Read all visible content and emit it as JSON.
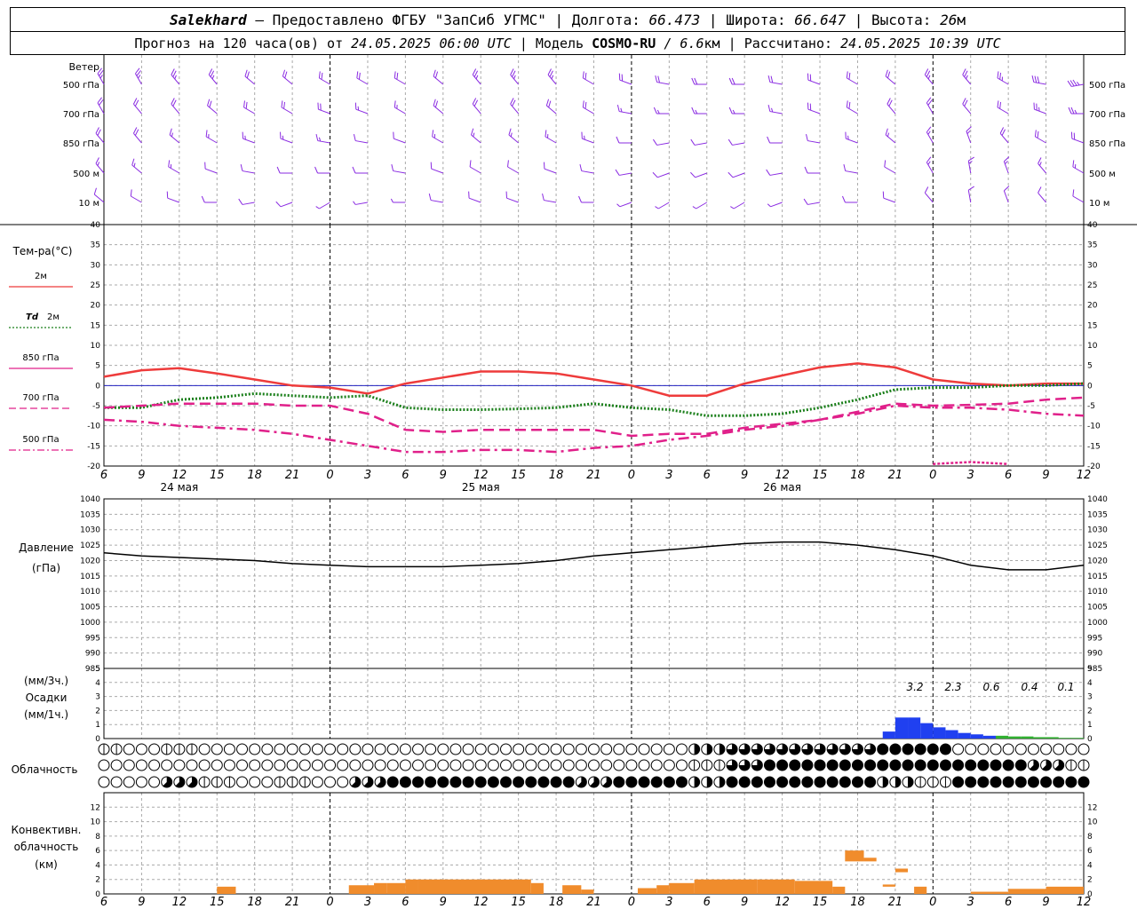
{
  "header": {
    "station": "Salekhard",
    "provider": "– Предоставлено ФГБУ \"ЗапСиб УГМС\"",
    "lon_label": "Долгота:",
    "lon_value": "66.473",
    "lat_label": "Широта:",
    "lat_value": "66.647",
    "alt_label": "Высота:",
    "alt_value": "26",
    "alt_unit": "м",
    "forecast_label": "Прогноз на 120 часа(ов) от",
    "forecast_start": "24.05.2025 06:00 UTC",
    "model_label": "Модель",
    "model_name": "COSMO-RU",
    "model_res": "/ 6.6",
    "model_res_unit": "км",
    "calc_label": "Рассчитано:",
    "calc_time": "24.05.2025 10:39 UTC",
    "sep": "|"
  },
  "x_axis": {
    "hour_labels": [
      "6",
      "9",
      "12",
      "15",
      "18",
      "21",
      "0",
      "3",
      "6",
      "9",
      "12",
      "15",
      "18",
      "21",
      "0",
      "3",
      "6",
      "9",
      "12",
      "15",
      "18",
      "21",
      "0",
      "3",
      "6",
      "9",
      "12"
    ],
    "day_labels": [
      "24 мая",
      "25 мая",
      "26 мая"
    ]
  },
  "wind_panel": {
    "title": "Ветер",
    "levels": [
      "500 гПа",
      "700 гПа",
      "850 гПа",
      "500 м",
      "10 м"
    ],
    "color": "#8a2be2"
  },
  "temp_panel": {
    "title": "Тем-ра(°C)",
    "legend": [
      {
        "label": "2м",
        "color": "#ee3b3b",
        "style": "solid"
      },
      {
        "label_prefix": "Td",
        "label": "2м",
        "color": "#1a7f1a",
        "style": "dotted"
      },
      {
        "label": "850 гПа",
        "color": "#e0208a",
        "style": "solid"
      },
      {
        "label": "700 гПа",
        "color": "#e0208a",
        "style": "dash"
      },
      {
        "label": "500 гПа",
        "color": "#e0208a",
        "style": "dashdot"
      }
    ]
  },
  "pressure_panel": {
    "title1": "Давление",
    "title2": "(гПа)"
  },
  "precip_panel": {
    "title1": "(мм/3ч.)",
    "title2": "Осадки",
    "title3": "(мм/1ч.)",
    "totals": [
      "3.2",
      "2.3",
      "0.6",
      "0.4",
      "0.1"
    ]
  },
  "cloud_panel": {
    "title": "Облачность"
  },
  "conv_panel": {
    "title1": "Конвективн.",
    "title2": "облачность",
    "title3": "(км)"
  },
  "chart_data": [
    {
      "type": "line",
      "name": "temperature",
      "ylim": [
        -20,
        40
      ],
      "yticks": [
        -20,
        -15,
        -10,
        -5,
        0,
        5,
        10,
        15,
        20,
        25,
        30,
        35,
        40
      ],
      "x_hours": [
        0,
        3,
        6,
        9,
        12,
        15,
        18,
        21,
        24,
        27,
        30,
        33,
        36,
        39,
        42,
        45,
        48,
        51,
        54,
        57,
        60,
        63,
        66,
        69,
        72,
        75,
        78
      ],
      "series": [
        {
          "name": "2м",
          "values": [
            2.2,
            3.8,
            4.3,
            3.0,
            1.5,
            0,
            -0.5,
            -2.0,
            0.5,
            2.0,
            3.5,
            3.5,
            3.0,
            1.5,
            0,
            -2.5,
            -2.5,
            0.5,
            2.5,
            4.5,
            5.5,
            4.5,
            1.5,
            0.5,
            0,
            0.5,
            0.5
          ]
        },
        {
          "name": "Td 2м",
          "values": [
            -5.5,
            -5.5,
            -3.5,
            -3.0,
            -2.0,
            -2.5,
            -3.0,
            -2.5,
            -5.5,
            -6.0,
            -6.0,
            -5.8,
            -5.5,
            -4.5,
            -5.5,
            -6.0,
            -7.5,
            -7.5,
            -7.0,
            -5.5,
            -3.5,
            -1.0,
            -0.5,
            -0.5,
            0,
            0,
            0.5
          ]
        },
        {
          "name": "850 гПа",
          "values": [
            null,
            null,
            null,
            null,
            null,
            null,
            null,
            null,
            null,
            null,
            null,
            null,
            null,
            null,
            null,
            null,
            null,
            null,
            null,
            null,
            null,
            null,
            -19.5,
            -19.0,
            -19.5,
            null,
            null
          ]
        },
        {
          "name": "700 гПа",
          "values": [
            -5.5,
            -5.0,
            -4.5,
            -4.5,
            -4.5,
            -5.0,
            -5.0,
            -7.0,
            -11.0,
            -11.5,
            -11.0,
            -11.0,
            -11.0,
            -11.0,
            -12.5,
            -12.0,
            -12.0,
            -10.5,
            -9.5,
            -8.5,
            -6.5,
            -4.5,
            -5.0,
            -4.8,
            -4.5,
            -3.5,
            -3.0
          ]
        },
        {
          "name": "500 гПа",
          "values": [
            -8.5,
            -9.0,
            -10.0,
            -10.5,
            -11.0,
            -12.0,
            -13.5,
            -15.0,
            -16.5,
            -16.5,
            -16.0,
            -16.0,
            -16.5,
            -15.5,
            -15.0,
            -13.5,
            -12.5,
            -11.0,
            -10.0,
            -8.5,
            -7.0,
            -5.0,
            -5.5,
            -5.5,
            -6.0,
            -7.0,
            -7.5
          ]
        }
      ]
    },
    {
      "type": "line",
      "name": "pressure",
      "ylim": [
        985,
        1040
      ],
      "yticks": [
        985,
        990,
        995,
        1000,
        1005,
        1010,
        1015,
        1020,
        1025,
        1030,
        1035,
        1040
      ],
      "x_hours": [
        0,
        3,
        6,
        9,
        12,
        15,
        18,
        21,
        24,
        27,
        30,
        33,
        36,
        39,
        42,
        45,
        48,
        51,
        54,
        57,
        60,
        63,
        66,
        69,
        72,
        75,
        78
      ],
      "series": [
        {
          "name": "Давление",
          "values": [
            1022.5,
            1021.5,
            1021.0,
            1020.5,
            1020.0,
            1019.0,
            1018.5,
            1018.0,
            1018.0,
            1018.0,
            1018.5,
            1019.0,
            1020.0,
            1021.5,
            1022.5,
            1023.5,
            1024.5,
            1025.5,
            1026.0,
            1026.0,
            1025.0,
            1023.5,
            1021.5,
            1018.5,
            1017.0,
            1017.0,
            1018.5
          ]
        }
      ]
    },
    {
      "type": "bar",
      "name": "precipitation",
      "ylim": [
        0,
        5
      ],
      "yticks": [
        0,
        1,
        2,
        3,
        4,
        5
      ],
      "hours": [
        63,
        64,
        65,
        66,
        67,
        68,
        69,
        70,
        71,
        72,
        73,
        74,
        75,
        76,
        77,
        78
      ],
      "values": [
        0.5,
        1.5,
        1.5,
        1.1,
        0.8,
        0.6,
        0.4,
        0.3,
        0.2,
        0.2,
        0.15,
        0.15,
        0.1,
        0.1,
        0.05,
        0.05
      ],
      "colors": [
        "#2040f0",
        "#2040f0",
        "#2040f0",
        "#2040f0",
        "#2040f0",
        "#2040f0",
        "#2040f0",
        "#2040f0",
        "#2040f0",
        "#30b030",
        "#30b030",
        "#30b030",
        "#30b030",
        "#30b030",
        "#30b030",
        "#30b030"
      ]
    },
    {
      "type": "bar",
      "name": "convective_cloud",
      "ylim": [
        0,
        14
      ],
      "yticks": [
        0,
        2,
        4,
        6,
        8,
        10,
        12
      ],
      "segments": [
        {
          "from": 9,
          "to": 10.5,
          "base": 0,
          "top": 1.0
        },
        {
          "from": 19.5,
          "to": 21.5,
          "base": 0,
          "top": 1.2
        },
        {
          "from": 21.5,
          "to": 22.5,
          "base": 0,
          "top": 1.5
        },
        {
          "from": 22.5,
          "to": 24,
          "base": 0,
          "top": 1.5
        },
        {
          "from": 24,
          "to": 25,
          "base": 0,
          "top": 2.0
        },
        {
          "from": 25,
          "to": 34,
          "base": 0,
          "top": 2.0
        },
        {
          "from": 34,
          "to": 35,
          "base": 0,
          "top": 1.5
        },
        {
          "from": 36.5,
          "to": 38,
          "base": 0,
          "top": 1.2
        },
        {
          "from": 38,
          "to": 39,
          "base": 0,
          "top": 0.6
        },
        {
          "from": 42.5,
          "to": 44,
          "base": 0,
          "top": 0.8
        },
        {
          "from": 44,
          "to": 45,
          "base": 0,
          "top": 1.2
        },
        {
          "from": 45,
          "to": 47,
          "base": 0,
          "top": 1.5
        },
        {
          "from": 47,
          "to": 52,
          "base": 0,
          "top": 2.0
        },
        {
          "from": 52,
          "to": 55,
          "base": 0,
          "top": 2.0
        },
        {
          "from": 55,
          "to": 58,
          "base": 0,
          "top": 1.8
        },
        {
          "from": 58,
          "to": 59,
          "base": 0,
          "top": 1.0
        },
        {
          "from": 59,
          "to": 60.5,
          "base": 4.5,
          "top": 6.0
        },
        {
          "from": 60.5,
          "to": 61.5,
          "base": 4.5,
          "top": 5.0
        },
        {
          "from": 62,
          "to": 63,
          "base": 1.0,
          "top": 1.3
        },
        {
          "from": 63,
          "to": 64,
          "base": 3.0,
          "top": 3.5
        },
        {
          "from": 64.5,
          "to": 65.5,
          "base": 0,
          "top": 1.0
        },
        {
          "from": 69,
          "to": 72,
          "base": 0,
          "top": 0.3
        },
        {
          "from": 72,
          "to": 75,
          "base": 0,
          "top": 0.7
        },
        {
          "from": 75,
          "to": 78,
          "base": 0,
          "top": 1.0
        }
      ]
    },
    {
      "type": "table",
      "name": "cloud_cover",
      "rows": [
        "upper",
        "middle",
        "lower"
      ],
      "hours": [
        0,
        3,
        6,
        9,
        12,
        15,
        18,
        21,
        24,
        27,
        30,
        33,
        36,
        39,
        42,
        45,
        48,
        51,
        54,
        57,
        60,
        63,
        66,
        69,
        72,
        75,
        78
      ],
      "upper": [
        1,
        0,
        1,
        0,
        0,
        0,
        0,
        0,
        0,
        0,
        0,
        0,
        0,
        0,
        0,
        0,
        4,
        6,
        6,
        6,
        6,
        8,
        8,
        0,
        0,
        0,
        0
      ],
      "middle": [
        0,
        0,
        0,
        0,
        0,
        0,
        0,
        0,
        0,
        0,
        0,
        0,
        0,
        0,
        0,
        0,
        2,
        6,
        8,
        8,
        8,
        8,
        8,
        8,
        8,
        5,
        2
      ],
      "lower": [
        0,
        0,
        5,
        1,
        0,
        1,
        0,
        5,
        8,
        8,
        8,
        8,
        8,
        5,
        8,
        8,
        4,
        8,
        8,
        8,
        8,
        4,
        1,
        8,
        8,
        8,
        8
      ]
    },
    {
      "type": "scatter",
      "name": "wind_barbs",
      "levels": [
        "500 гПа",
        "700 гПа",
        "850 гПа",
        "500 м",
        "10 м"
      ],
      "x_hours": [
        0,
        3,
        6,
        9,
        12,
        15,
        18,
        21,
        24,
        27,
        30,
        33,
        36,
        39,
        42,
        45,
        48,
        51,
        54,
        57,
        60,
        63,
        66,
        69,
        72,
        75,
        78
      ],
      "direction_deg": [
        [
          330,
          330,
          320,
          320,
          310,
          310,
          300,
          300,
          300,
          310,
          320,
          320,
          320,
          300,
          290,
          280,
          270,
          270,
          280,
          290,
          300,
          310,
          320,
          320,
          300,
          280,
          260
        ],
        [
          330,
          320,
          320,
          310,
          300,
          300,
          290,
          290,
          300,
          310,
          320,
          320,
          310,
          300,
          280,
          270,
          270,
          270,
          280,
          290,
          300,
          320,
          330,
          320,
          300,
          290,
          270
        ],
        [
          320,
          320,
          310,
          300,
          290,
          290,
          280,
          280,
          290,
          300,
          310,
          310,
          300,
          290,
          270,
          260,
          260,
          260,
          270,
          280,
          290,
          310,
          330,
          340,
          320,
          300,
          290
        ],
        [
          320,
          310,
          300,
          290,
          280,
          270,
          270,
          270,
          280,
          290,
          300,
          300,
          290,
          280,
          260,
          250,
          250,
          250,
          260,
          270,
          280,
          300,
          330,
          350,
          340,
          320,
          300
        ],
        [
          310,
          300,
          290,
          270,
          260,
          250,
          240,
          260,
          270,
          280,
          290,
          290,
          280,
          270,
          250,
          240,
          240,
          240,
          250,
          260,
          270,
          290,
          320,
          350,
          340,
          320,
          300
        ]
      ],
      "speed_ms": [
        [
          14,
          14,
          13,
          13,
          12,
          12,
          12,
          11,
          11,
          12,
          13,
          13,
          13,
          12,
          11,
          10,
          10,
          10,
          10,
          11,
          12,
          12,
          13,
          13,
          14,
          16,
          18
        ],
        [
          12,
          12,
          11,
          11,
          10,
          10,
          10,
          9,
          9,
          10,
          11,
          11,
          11,
          10,
          9,
          9,
          9,
          9,
          9,
          10,
          10,
          11,
          11,
          12,
          12,
          13,
          14
        ],
        [
          10,
          10,
          9,
          9,
          8,
          8,
          8,
          7,
          7,
          8,
          9,
          9,
          9,
          8,
          7,
          7,
          7,
          7,
          7,
          7,
          8,
          9,
          9,
          9,
          10,
          10,
          11
        ],
        [
          8,
          8,
          8,
          7,
          7,
          7,
          6,
          6,
          6,
          7,
          7,
          7,
          7,
          7,
          6,
          6,
          6,
          6,
          6,
          6,
          7,
          7,
          8,
          8,
          8,
          8,
          9
        ],
        [
          6,
          6,
          5,
          5,
          5,
          5,
          4,
          4,
          4,
          5,
          5,
          5,
          5,
          5,
          4,
          4,
          4,
          4,
          4,
          5,
          5,
          5,
          6,
          6,
          6,
          6,
          6
        ]
      ]
    }
  ]
}
